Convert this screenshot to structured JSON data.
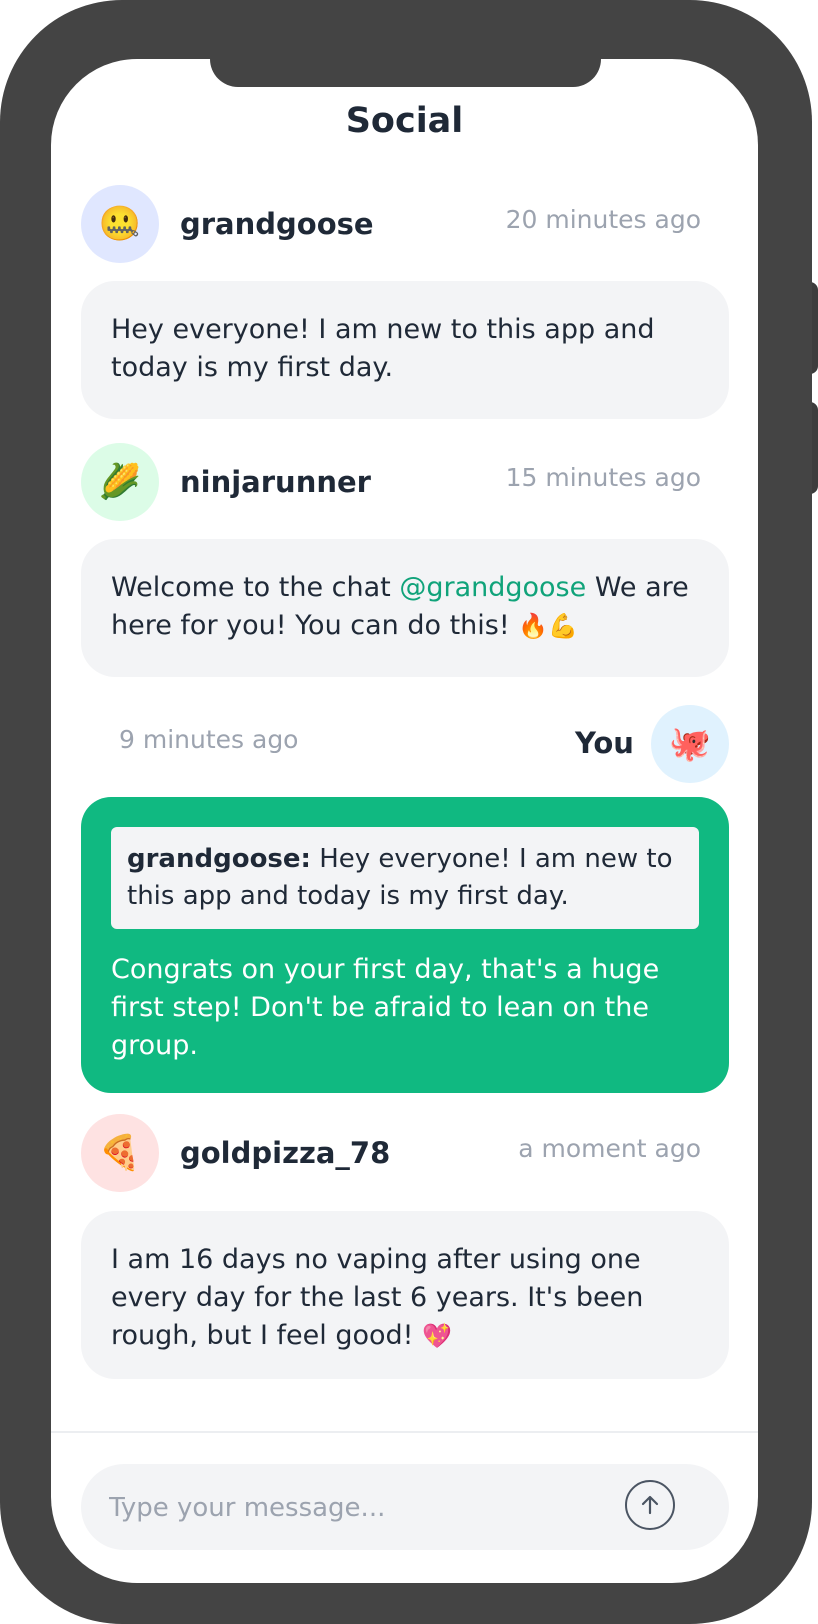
{
  "app": {
    "title": "Social"
  },
  "messages": [
    {
      "user": "grandgoose",
      "avatar_emoji": "🤐",
      "avatar_bg": "#e0e7ff",
      "time": "20 minutes ago",
      "text": "Hey everyone! I am new to this app and today is my first day."
    },
    {
      "user": "ninjarunner",
      "avatar_emoji": "🌽",
      "avatar_bg": "#dcfce7",
      "time": "15 minutes ago",
      "text_before": "Welcome to the chat ",
      "mention": "@grandgoose",
      "text_after": " We are here for you! You can do this! ",
      "emojis": "🔥💪"
    },
    {
      "user": "You",
      "avatar_emoji": "🐙",
      "avatar_bg": "#e0f2fe",
      "time": "9 minutes ago",
      "quote_user": "grandgoose:",
      "quote_text": " Hey everyone! I am new to this app and today is my first day.",
      "text": "Congrats on your first day, that's a huge first step! Don't be afraid to lean on the group.",
      "bubble_color": "#10b981"
    },
    {
      "user": "goldpizza_78",
      "avatar_emoji": "🍕",
      "avatar_bg": "#fee2e2",
      "time": "a moment ago",
      "text": "I am 16 days no vaping after using one every day for the last 6 years. It's been rough, but I feel good! ",
      "emojis": "💖"
    }
  ],
  "composer": {
    "placeholder": "Type your message...",
    "send_icon": "arrow-up-icon"
  }
}
